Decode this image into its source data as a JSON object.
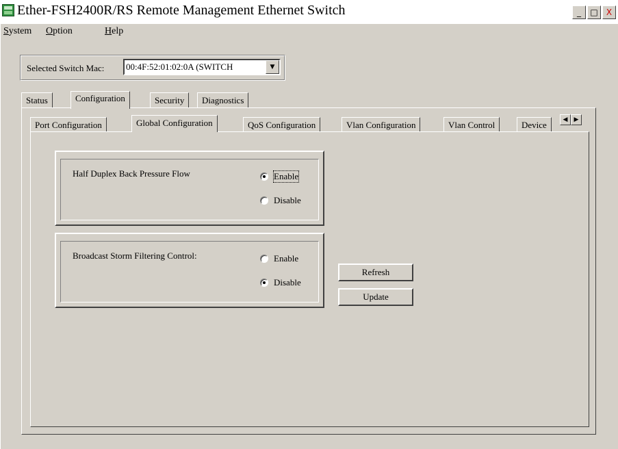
{
  "window": {
    "title": "Ether-FSH2400R/RS Remote Management Ethernet Switch",
    "icon": "app-icon",
    "controls": {
      "minimize": "_",
      "maximize": "□",
      "close": "X"
    }
  },
  "menubar": {
    "items": [
      {
        "label": "System",
        "mnemonic": "S"
      },
      {
        "label": "Option",
        "mnemonic": "O"
      },
      {
        "label": "Help",
        "mnemonic": "H"
      }
    ]
  },
  "switch_selector": {
    "label": "Selected Switch Mac:",
    "value": "00:4F:52:01:02:0A (SWITCH"
  },
  "main_tabs": [
    {
      "label": "Status",
      "active": false
    },
    {
      "label": "Configuration",
      "active": true
    },
    {
      "label": "Security",
      "active": false
    },
    {
      "label": "Diagnostics",
      "active": false
    }
  ],
  "config_tabs": [
    {
      "label": "Port Configuration",
      "active": false
    },
    {
      "label": "Global Configuration",
      "active": true
    },
    {
      "label": "QoS Configuration",
      "active": false
    },
    {
      "label": "Vlan Configuration",
      "active": false
    },
    {
      "label": "Vlan Control",
      "active": false
    },
    {
      "label": "Device",
      "active": false
    }
  ],
  "half_duplex": {
    "label": "Half Duplex Back Pressure Flow",
    "options": [
      {
        "label": "Enable",
        "checked": true
      },
      {
        "label": "Disable",
        "checked": false
      }
    ]
  },
  "broadcast_storm": {
    "label": "Broadcast Storm Filtering Control:",
    "options": [
      {
        "label": "Enable",
        "checked": false
      },
      {
        "label": "Disable",
        "checked": true
      }
    ]
  },
  "buttons": {
    "refresh": "Refresh",
    "update": "Update"
  }
}
